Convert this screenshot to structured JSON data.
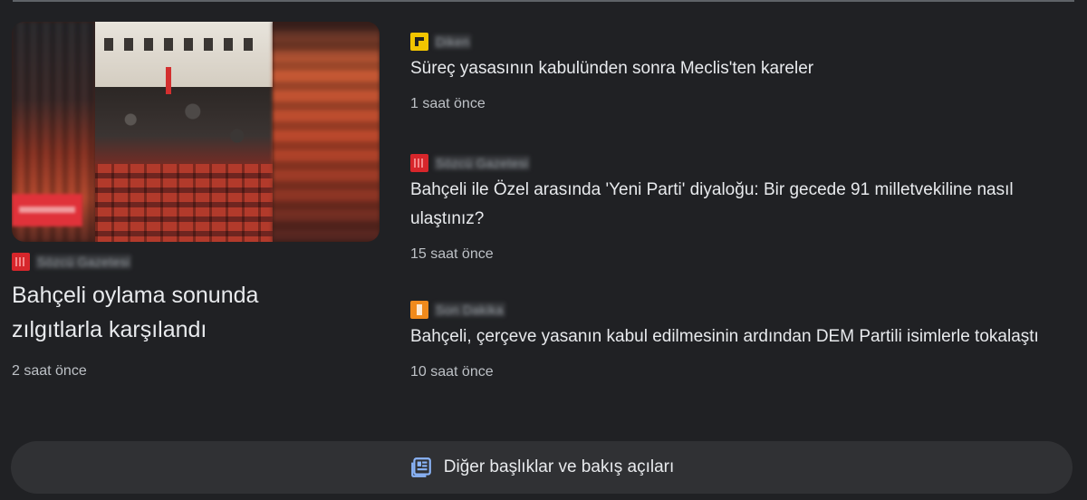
{
  "lead": {
    "source": "Sözcü Gazetesi",
    "title": "Bahçeli oylama sonunda zılgıtlarla karşılandı",
    "time": "2 saat önce"
  },
  "stories": [
    {
      "source": "Diken",
      "title": "Süreç yasasının kabulünden sonra Meclis'ten kareler",
      "time": "1 saat önce",
      "logo_color": "#f2c500"
    },
    {
      "source": "Sözcü Gazetesi",
      "title": "Bahçeli ile Özel arasında 'Yeni Parti' diyaloğu: Bir gecede 91 milletvekiline nasıl ulaştınız?",
      "time": "15 saat önce",
      "logo_color": "#d7262b"
    },
    {
      "source": "Son Dakika",
      "title": "Bahçeli, çerçeve yasanın kabul edilmesinin ardından DEM Partili isimlerle tokalaştı",
      "time": "10 saat önce",
      "logo_color": "#f08a1c"
    }
  ],
  "more_button": {
    "label": "Diğer başlıklar ve bakış açıları",
    "icon": "newspaper-icon",
    "icon_color": "#8ab4f8"
  }
}
